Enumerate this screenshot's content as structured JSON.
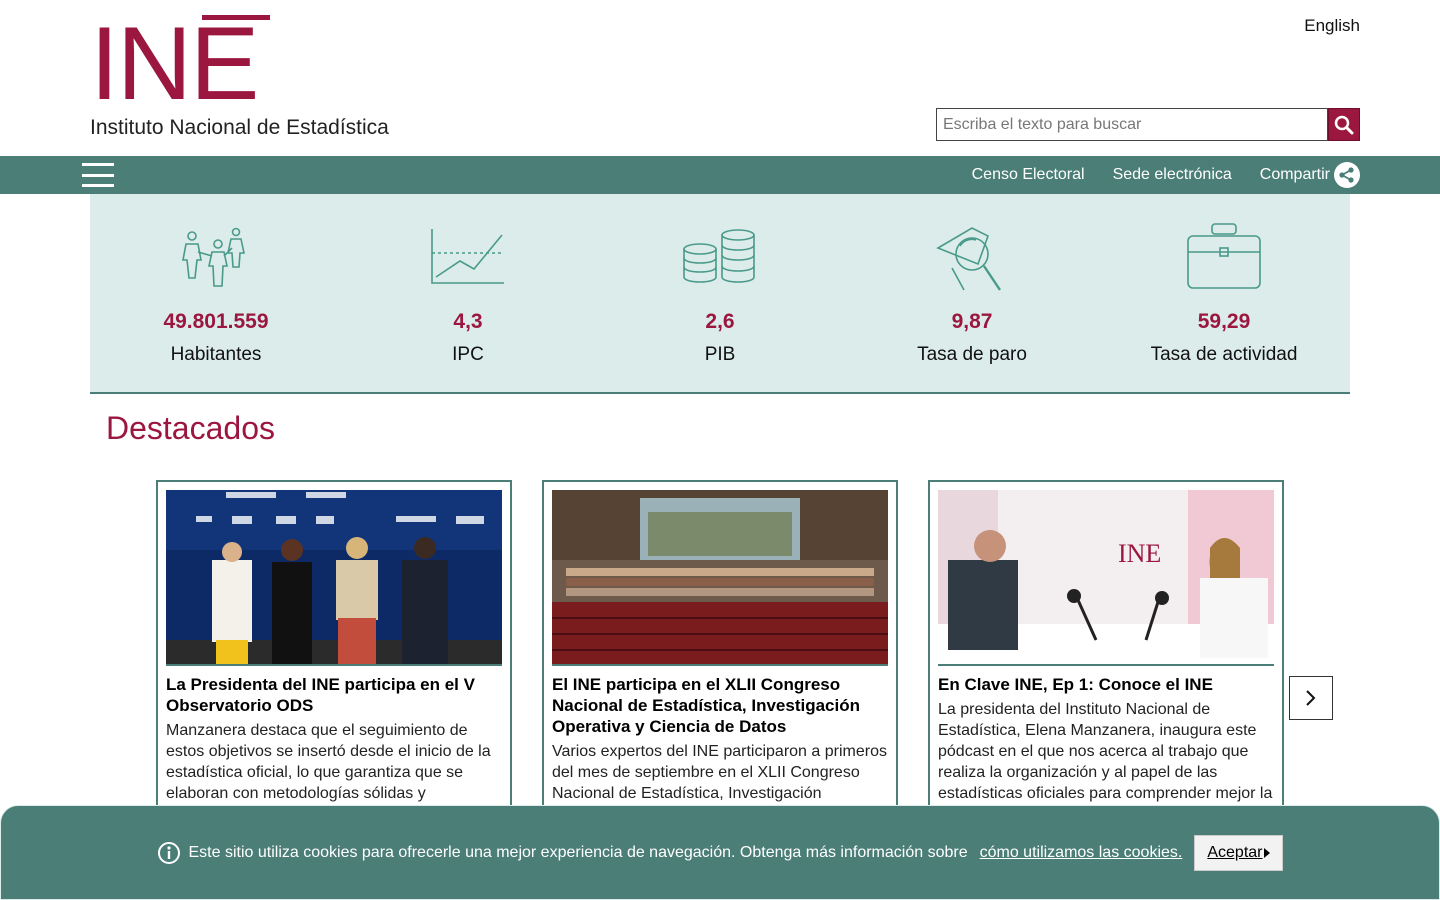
{
  "header": {
    "logo_mark": "INE",
    "logo_subtitle": "Instituto Nacional de Estadística",
    "language_link": "English",
    "search_placeholder": "Escriba el texto para buscar"
  },
  "nav": {
    "links": [
      "Censo Electoral",
      "Sede electrónica",
      "Compartir"
    ]
  },
  "indicators": [
    {
      "icon": "people-icon",
      "value": "49.801.559",
      "label": "Habitantes"
    },
    {
      "icon": "line-chart-icon",
      "value": "4,3",
      "label": "IPC"
    },
    {
      "icon": "coins-icon",
      "value": "2,6",
      "label": "PIB"
    },
    {
      "icon": "magnifier-icon",
      "value": "9,87",
      "label": "Tasa de paro"
    },
    {
      "icon": "briefcase-icon",
      "value": "59,29",
      "label": "Tasa de actividad"
    }
  ],
  "section_title": "Destacados",
  "cards": [
    {
      "title": "La Presidenta del INE participa en el V Observatorio ODS",
      "text": "Manzanera destaca que el seguimiento de estos objetivos se insertó desde el inicio de la estadística oficial, lo que garantiza que se elaboran con metodologías sólidas y"
    },
    {
      "title": "El INE participa en el XLII Congreso Nacional de Estadística, Investigación Operativa y Ciencia de Datos",
      "text": "Varios expertos del INE participaron a primeros del mes de septiembre en el XLII Congreso Nacional de Estadística, Investigación"
    },
    {
      "title": "En Clave INE, Ep 1: Conoce el INE",
      "text": "La presidenta del Instituto Nacional de Estadística, Elena Manzanera, inaugura este pódcast en el que nos acerca al trabajo que realiza la organización y al papel de las estadísticas oficiales para comprender mejor la"
    }
  ],
  "cookie": {
    "text": "Este sitio utiliza cookies para ofrecerle una mejor experiencia de navegación. Obtenga más información sobre",
    "link": "cómo utilizamos las cookies.",
    "accept": "Aceptar"
  },
  "colors": {
    "brand": "#9b1740",
    "teal": "#4a7e76",
    "light_teal": "#dbeceb"
  }
}
